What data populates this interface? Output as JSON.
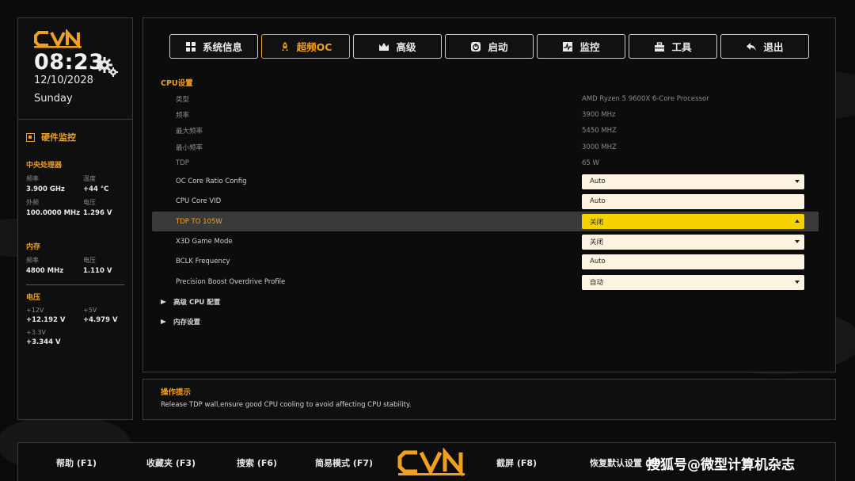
{
  "brand": {
    "logo_text": "CVN"
  },
  "clock": {
    "time": "08:23",
    "date": "12/10/2028",
    "weekday": "Sunday"
  },
  "hardware_monitor": {
    "title": "硬件监控",
    "cpu": {
      "title": "中央处理器",
      "freq_label": "频率",
      "freq_value": "3.900 GHz",
      "temp_label": "温度",
      "temp_value": "+44 °C",
      "bclk_label": "外频",
      "bclk_value": "100.0000 MHz",
      "volt_label": "电压",
      "volt_value": "1.296 V"
    },
    "memory": {
      "title": "内存",
      "freq_label": "频率",
      "freq_value": "4800 MHz",
      "volt_label": "电压",
      "volt_value": "1.110 V"
    },
    "voltage": {
      "title": "电压",
      "v12_label": "+12V",
      "v12_value": "+12.192 V",
      "v5_label": "+5V",
      "v5_value": "+4.979 V",
      "v33_label": "+3.3V",
      "v33_value": "+3.344 V"
    }
  },
  "tabs": [
    {
      "label": "系统信息",
      "icon": "grid-icon",
      "active": false
    },
    {
      "label": "超频OC",
      "icon": "rocket-icon",
      "active": true
    },
    {
      "label": "高级",
      "icon": "crown-icon",
      "active": false
    },
    {
      "label": "启动",
      "icon": "power-icon",
      "active": false
    },
    {
      "label": "监控",
      "icon": "pulse-icon",
      "active": false
    },
    {
      "label": "工具",
      "icon": "toolbox-icon",
      "active": false
    },
    {
      "label": "退出",
      "icon": "back-arrow-icon",
      "active": false
    }
  ],
  "cpu_settings": {
    "title": "CPU设置",
    "info": [
      {
        "label": "类型",
        "value": "AMD Ryzen 5 9600X 6-Core Processor"
      },
      {
        "label": "频率",
        "value": "3900 MHz"
      },
      {
        "label": "最大频率",
        "value": "5450 MHZ"
      },
      {
        "label": "最小频率",
        "value": "3000 MHZ"
      },
      {
        "label": "TDP",
        "value": "65 W"
      }
    ],
    "options": [
      {
        "label": "OC Core Ratio Config",
        "value": "Auto",
        "dropdown": true
      },
      {
        "label": "CPU Core VID",
        "value": "Auto",
        "dropdown": false
      },
      {
        "label": "TDP TO 105W",
        "value": "关闭",
        "dropdown": true,
        "selected": true
      },
      {
        "label": "X3D Game Mode",
        "value": "关闭",
        "dropdown": true
      },
      {
        "label": "BCLK Frequency",
        "value": "Auto",
        "dropdown": false
      },
      {
        "label": "Precision Boost Overdrive Profile",
        "value": "自动",
        "dropdown": true
      }
    ],
    "submenus": [
      {
        "label": "高级 CPU 配置"
      },
      {
        "label": "内存设置"
      }
    ]
  },
  "hint": {
    "title": "操作提示",
    "text": "Release TDP wall,ensure good CPU cooling to avoid affecting CPU stability."
  },
  "footer": {
    "help": "帮助 (F1)",
    "favorites": "收藏夹 (F3)",
    "search": "搜索 (F6)",
    "easy_mode": "简易模式 (F7)",
    "screenshot": "截屏 (F8)",
    "restore_defaults": "恢复默认设置 (F9"
  },
  "watermark": "搜狐号@微型计算机杂志",
  "colors": {
    "accent": "#f0a020",
    "highlight_field": "#f6d200",
    "field_bg": "#fdf3e1"
  }
}
